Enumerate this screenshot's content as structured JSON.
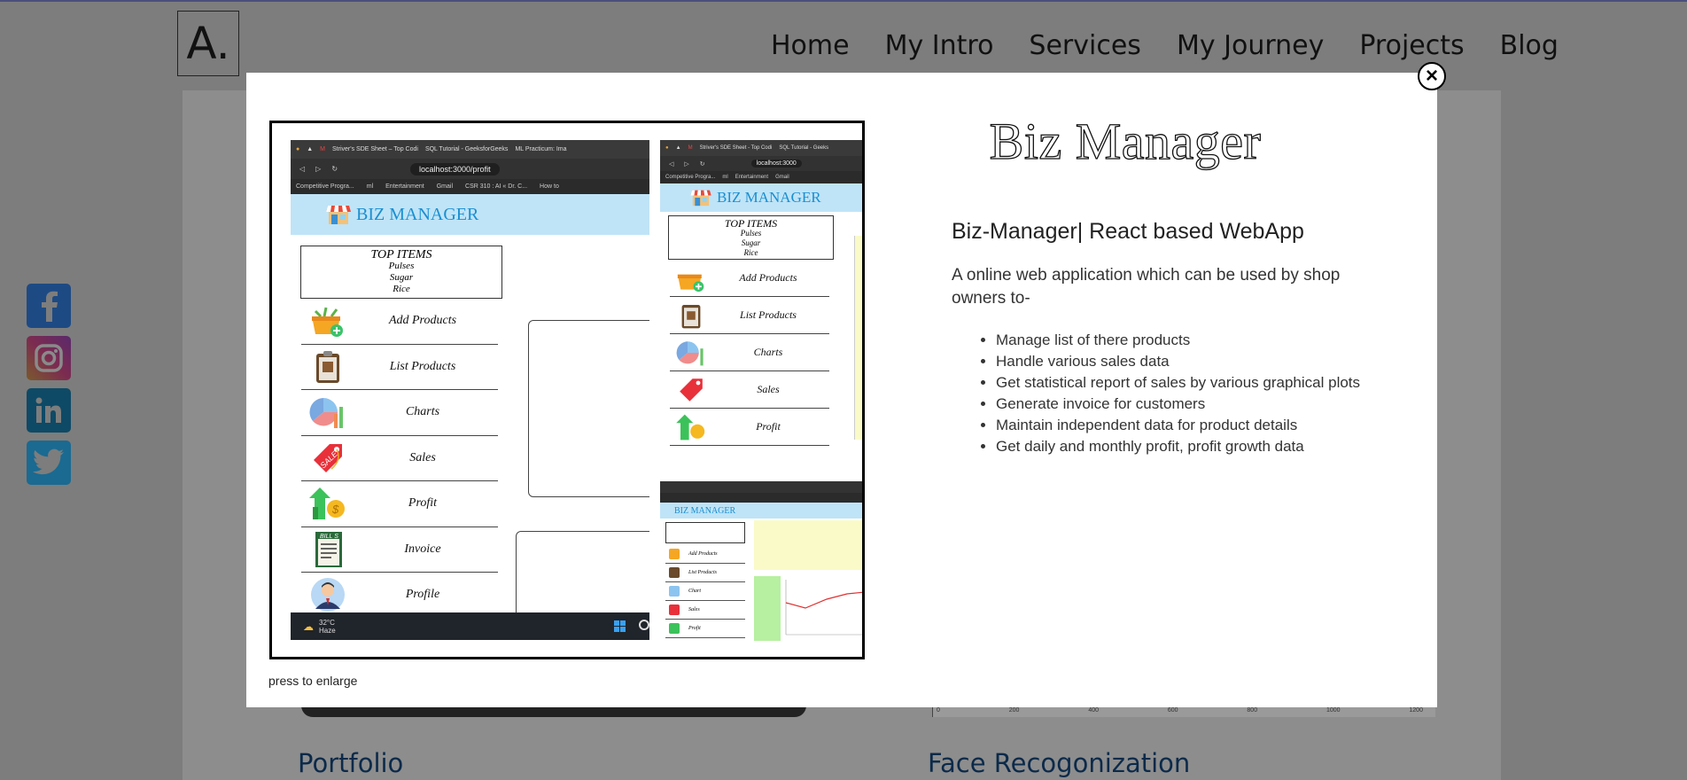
{
  "site": {
    "logo": "A.",
    "nav": [
      "Home",
      "My Intro",
      "Services",
      "My Journey",
      "Projects",
      "Blog"
    ],
    "social": [
      "facebook-icon",
      "instagram-icon",
      "linkedin-icon",
      "twitter-icon"
    ],
    "cards": [
      "Portfolio",
      "Face Recogonization"
    ],
    "peek_axis_ticks": [
      "0",
      "200",
      "400",
      "600",
      "800",
      "1000",
      "1200"
    ]
  },
  "modal": {
    "close_label": "×",
    "enlarge_hint": "press to enlarge",
    "project_title": "Biz Manager",
    "project_subtitle": "Biz-Manager| React based WebApp",
    "project_description": "A online web application which can be used by shop owners to-",
    "features": [
      "Manage list of there products",
      "Handle various sales data",
      "Get statistical report of sales by various graphical plots",
      "Generate invoice for customers",
      "Maintain independent data for product details",
      "Get daily and monthly profit, profit growth data"
    ]
  },
  "screenshot": {
    "tabs": [
      "Striver's SDE Sheet – Top Codi",
      "SQL Tutorial - GeeksforGeeks",
      "ML Practicum: Ima"
    ],
    "side_tabs": [
      "Striver's SDE Sheet - Top Codi",
      "SQL Tutorial - Geeks"
    ],
    "address": "localhost:3000/profit",
    "side_address": "localhost:3000",
    "bookmarks": [
      "Competitive Progra...",
      "ml",
      "Entertainment",
      "Gmail",
      "CSR 310 : AI « Dr. C...",
      "How to"
    ],
    "side_bookmarks": [
      "Competitive Progra...",
      "ml",
      "Entertainment",
      "Gmail"
    ],
    "app_title": "BIZ MANAGER",
    "top_items_title": "TOP ITEMS",
    "top_items": [
      "Pulses",
      "Sugar",
      "Rice"
    ],
    "menu": [
      "Add Products",
      "List Products",
      "Charts",
      "Sales",
      "Profit",
      "Invoice",
      "Profile"
    ],
    "mini_menu": [
      "Add Products",
      "List Products",
      "Chart",
      "Sales",
      "Profit"
    ],
    "weather_temp": "32°C",
    "weather_desc": "Haze",
    "bill_icon_text": "BILL S"
  }
}
